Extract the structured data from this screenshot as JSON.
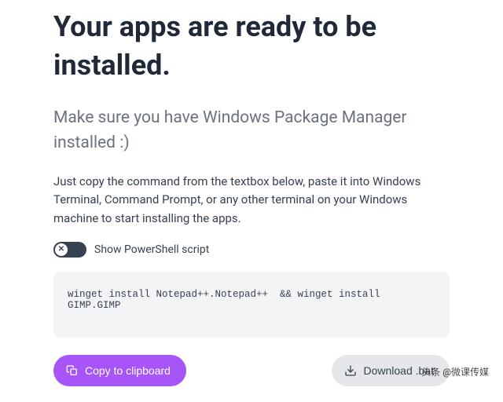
{
  "heading": "Your apps are ready to be installed.",
  "subheading": "Make sure you have Windows Package Manager installed :)",
  "description": "Just copy the command from the textbox below, paste it into Windows Terminal, Command Prompt, or any other terminal on your Windows machine to start installing the apps.",
  "toggle": {
    "label": "Show PowerShell script",
    "state": false,
    "icon_glyph": "✕"
  },
  "command": "winget install Notepad++.Notepad++  && winget install GIMP.GIMP",
  "buttons": {
    "copy_label": "Copy to clipboard",
    "download_label": "Download .bat"
  },
  "watermark": "头条 @微课传媒"
}
